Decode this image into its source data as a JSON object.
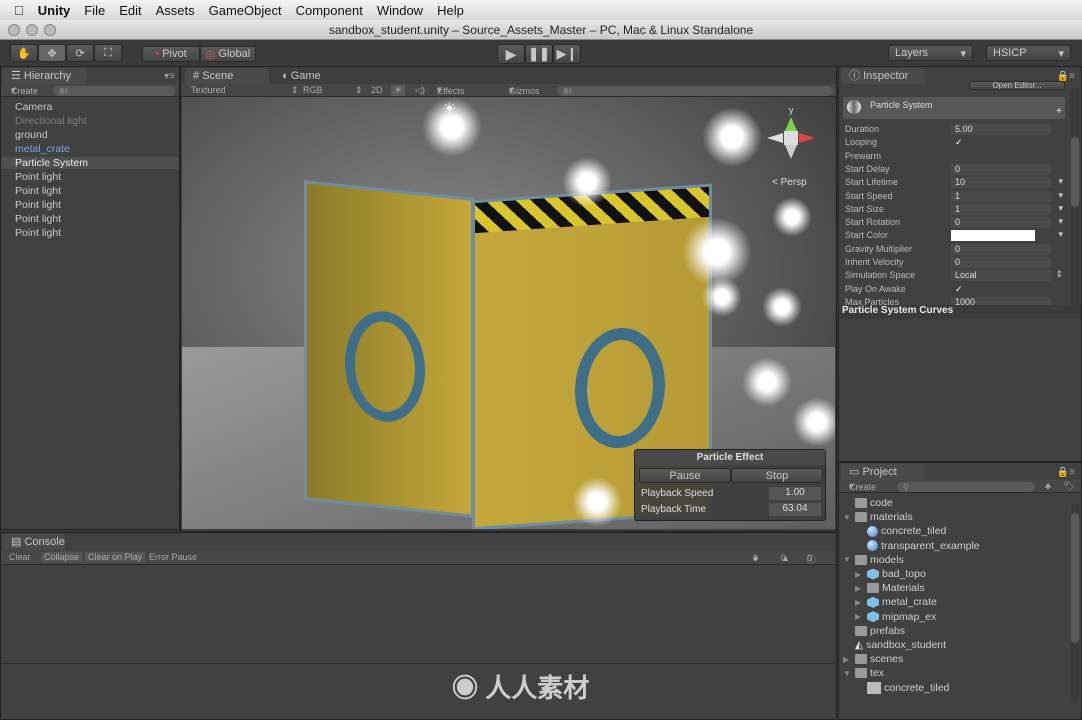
{
  "menubar": {
    "app": "Unity",
    "items": [
      "File",
      "Edit",
      "Assets",
      "GameObject",
      "Component",
      "Window",
      "Help"
    ]
  },
  "window_title": "sandbox_student.unity – Source_Assets_Master – PC, Mac & Linux Standalone",
  "toolbar": {
    "pivot": "Pivot",
    "global": "Global",
    "layers": "Layers",
    "layout": "HSICP"
  },
  "hierarchy": {
    "tab": "Hierarchy",
    "create": "Create",
    "search_placeholder": "All",
    "items": [
      {
        "label": "Camera",
        "state": "normal"
      },
      {
        "label": "Directional light",
        "state": "disabled"
      },
      {
        "label": "ground",
        "state": "normal"
      },
      {
        "label": "metal_crate",
        "state": "prefab"
      },
      {
        "label": "Particle System",
        "state": "selected"
      },
      {
        "label": "Point light",
        "state": "normal"
      },
      {
        "label": "Point light",
        "state": "normal"
      },
      {
        "label": "Point light",
        "state": "normal"
      },
      {
        "label": "Point light",
        "state": "normal"
      },
      {
        "label": "Point light",
        "state": "normal"
      }
    ]
  },
  "scene": {
    "tab_scene": "Scene",
    "tab_game": "Game",
    "shading": "Textured",
    "render": "RGB",
    "mode_2d": "2D",
    "effects": "Effects",
    "gizmos": "Gizmos",
    "search_placeholder": "All",
    "persp": "Persp",
    "gizmo_axis": "y"
  },
  "particle_effect": {
    "title": "Particle Effect",
    "pause": "Pause",
    "stop": "Stop",
    "playback_speed_label": "Playback Speed",
    "playback_speed": "1.00",
    "playback_time_label": "Playback Time",
    "playback_time": "63.04"
  },
  "inspector": {
    "tab": "Inspector",
    "open_editor": "Open Editor...",
    "component": "Particle System",
    "rows": [
      {
        "label": "Duration",
        "value": "5.00"
      },
      {
        "label": "Looping",
        "value": "✓"
      },
      {
        "label": "Prewarm",
        "value": ""
      },
      {
        "label": "Start Delay",
        "value": "0"
      },
      {
        "label": "Start Lifetime",
        "value": "10",
        "dd": "▾"
      },
      {
        "label": "Start Speed",
        "value": "1",
        "dd": "▾"
      },
      {
        "label": "Start Size",
        "value": "1",
        "dd": "▾"
      },
      {
        "label": "Start Rotation",
        "value": "0",
        "dd": "▾"
      },
      {
        "label": "Start Color",
        "value": "",
        "dd": "▾"
      },
      {
        "label": "Gravity Multiplier",
        "value": "0"
      },
      {
        "label": "Inherit Velocity",
        "value": "0"
      },
      {
        "label": "Simulation Space",
        "value": "Local",
        "dd": "⇕"
      },
      {
        "label": "Play On Awake",
        "value": "✓"
      },
      {
        "label": "Max Particles",
        "value": "1000"
      }
    ],
    "curves": "Particle System Curves"
  },
  "project": {
    "tab": "Project",
    "create": "Create",
    "items": [
      {
        "label": "code",
        "icon": "folder",
        "indent": 0,
        "arrow": ""
      },
      {
        "label": "materials",
        "icon": "folder",
        "indent": 0,
        "arrow": "▼"
      },
      {
        "label": "concrete_tiled",
        "icon": "sphere",
        "indent": 1,
        "arrow": ""
      },
      {
        "label": "transparent_example",
        "icon": "sphere",
        "indent": 1,
        "arrow": ""
      },
      {
        "label": "models",
        "icon": "folder",
        "indent": 0,
        "arrow": "▼"
      },
      {
        "label": "bad_topo",
        "icon": "mesh",
        "indent": 1,
        "arrow": "▶"
      },
      {
        "label": "Materials",
        "icon": "folder",
        "indent": 1,
        "arrow": "▶"
      },
      {
        "label": "metal_crate",
        "icon": "mesh",
        "indent": 1,
        "arrow": "▶"
      },
      {
        "label": "mipmap_ex",
        "icon": "mesh",
        "indent": 1,
        "arrow": "▶"
      },
      {
        "label": "prefabs",
        "icon": "folder",
        "indent": 0,
        "arrow": ""
      },
      {
        "label": "sandbox_student",
        "icon": "unity",
        "indent": 0,
        "arrow": ""
      },
      {
        "label": "scenes",
        "icon": "folder",
        "indent": 0,
        "arrow": "▶"
      },
      {
        "label": "tex",
        "icon": "folder",
        "indent": 0,
        "arrow": "▼"
      },
      {
        "label": "concrete_tiled",
        "icon": "texture",
        "indent": 1,
        "arrow": ""
      }
    ]
  },
  "console": {
    "tab": "Console",
    "clear": "Clear",
    "collapse": "Collapse",
    "clear_on_play": "Clear on Play",
    "error_pause": "Error Pause",
    "errors": "0",
    "warnings": "0",
    "logs": "0"
  },
  "watermark": "人人素材"
}
